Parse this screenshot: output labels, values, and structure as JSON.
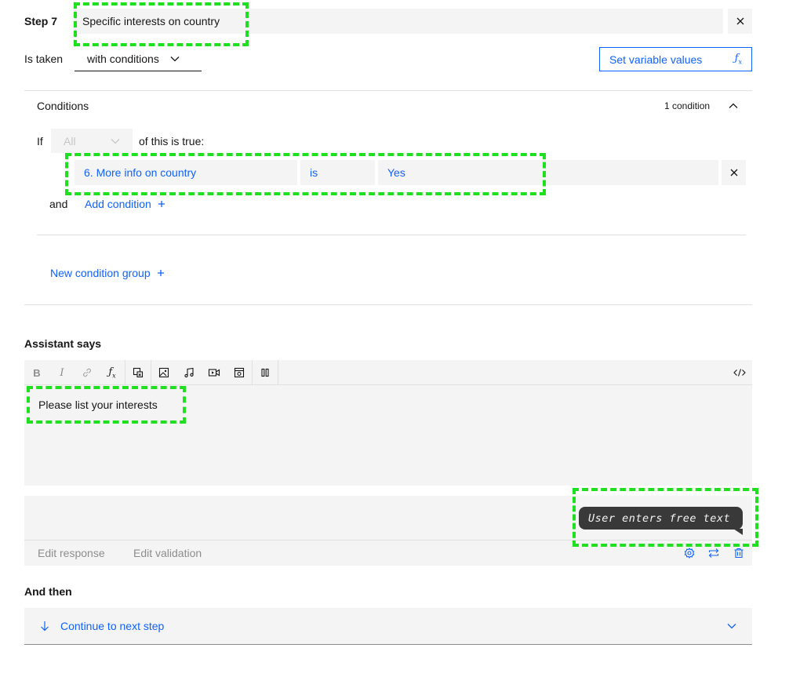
{
  "step": {
    "label": "Step 7",
    "title": "Specific interests on country"
  },
  "taken": {
    "label": "Is taken",
    "value": "with conditions"
  },
  "set_variable": {
    "label": "Set variable values"
  },
  "conditions": {
    "title": "Conditions",
    "count": "1 condition",
    "if_label": "If",
    "scope_value": "All",
    "of_label": "of this is true:",
    "row": {
      "field": "6. More info on country",
      "operator": "is",
      "value": "Yes"
    },
    "and_label": "and",
    "add_condition": "Add condition",
    "new_group": "New condition group"
  },
  "assistant": {
    "label": "Assistant says",
    "text": "Please list your interests",
    "toolbar": [
      "bold-icon",
      "italic-icon",
      "link-icon",
      "function-icon",
      "variable-icon",
      "image-icon",
      "audio-icon",
      "video-icon",
      "iframe-icon",
      "pause-icon",
      "code-icon"
    ]
  },
  "response": {
    "bubble": "User enters free text",
    "edit_response": "Edit response",
    "edit_validation": "Edit validation"
  },
  "and_then": {
    "label": "And then",
    "value": "Continue to next step"
  },
  "colors": {
    "accent": "#0f62fe",
    "field_bg": "#f4f4f4",
    "bubble_bg": "#393939",
    "highlight": "#1ee01e"
  }
}
